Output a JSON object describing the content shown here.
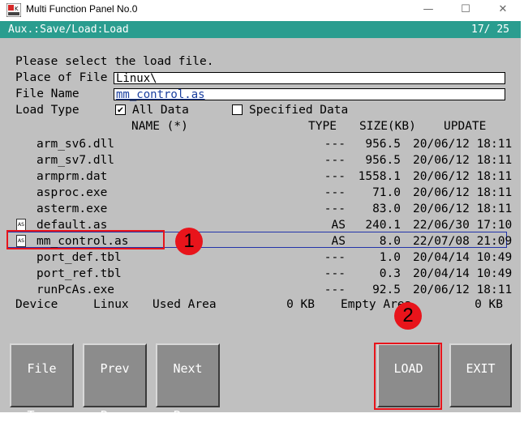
{
  "window": {
    "title": "Multi Function Panel No.0",
    "controls": {
      "minimize": "—",
      "maximize": "☐",
      "close": "✕"
    }
  },
  "statusbar": {
    "path": "Aux.:Save/Load:Load",
    "page": "17/ 25"
  },
  "form": {
    "prompt": "Please select the load file.",
    "place_label": "Place of File",
    "place_value": "Linux\\",
    "name_label": "File Name",
    "name_value": "mm_control.as",
    "type_label": "Load Type",
    "all_data_label": "All Data",
    "all_data_checked": true,
    "specified_label": "Specified Data",
    "specified_checked": false
  },
  "table": {
    "headers": {
      "name": "NAME  (*)",
      "type": "TYPE",
      "size": "SIZE(KB)",
      "update": "UPDATE"
    },
    "rows": [
      {
        "name": "arm_sv6.dll",
        "type": "---",
        "size": "956.5",
        "update": "20/06/12 18:11",
        "icon": false
      },
      {
        "name": "arm_sv7.dll",
        "type": "---",
        "size": "956.5",
        "update": "20/06/12 18:11",
        "icon": false
      },
      {
        "name": "armprm.dat",
        "type": "---",
        "size": "1558.1",
        "update": "20/06/12 18:11",
        "icon": false
      },
      {
        "name": "asproc.exe",
        "type": "---",
        "size": "71.0",
        "update": "20/06/12 18:11",
        "icon": false
      },
      {
        "name": "asterm.exe",
        "type": "---",
        "size": "83.0",
        "update": "20/06/12 18:11",
        "icon": false
      },
      {
        "name": "default.as",
        "type": "AS",
        "size": "240.1",
        "update": "22/06/30 17:10",
        "icon": true
      },
      {
        "name": "mm_control.as",
        "type": "AS",
        "size": "8.0",
        "update": "22/07/08 21:09",
        "icon": true
      },
      {
        "name": "port_def.tbl",
        "type": "---",
        "size": "1.0",
        "update": "20/04/14 10:49",
        "icon": false
      },
      {
        "name": "port_ref.tbl",
        "type": "---",
        "size": "0.3",
        "update": "20/04/14 10:49",
        "icon": false
      },
      {
        "name": "runPcAs.exe",
        "type": "---",
        "size": "92.5",
        "update": "20/06/12 18:11",
        "icon": false
      }
    ],
    "selected_index": 6,
    "icon_label": "AS"
  },
  "device": {
    "label": "Device",
    "value": "Linux",
    "used_label": "Used Area",
    "used_value": "0 KB",
    "empty_label": "Empty Area",
    "empty_value": "0 KB"
  },
  "buttons": {
    "file_type": "File Type",
    "prev_page": "Prev Page",
    "next_page": "Next Page",
    "load": "LOAD",
    "exit": "EXIT"
  },
  "annotations": {
    "step1": "1",
    "step2": "2"
  },
  "colors": {
    "statusbar": "#2a9d8f",
    "panel": "#c0c0c0",
    "button": "#8c8c8c",
    "highlight": "#e8141b",
    "selection": "#2233aa"
  }
}
